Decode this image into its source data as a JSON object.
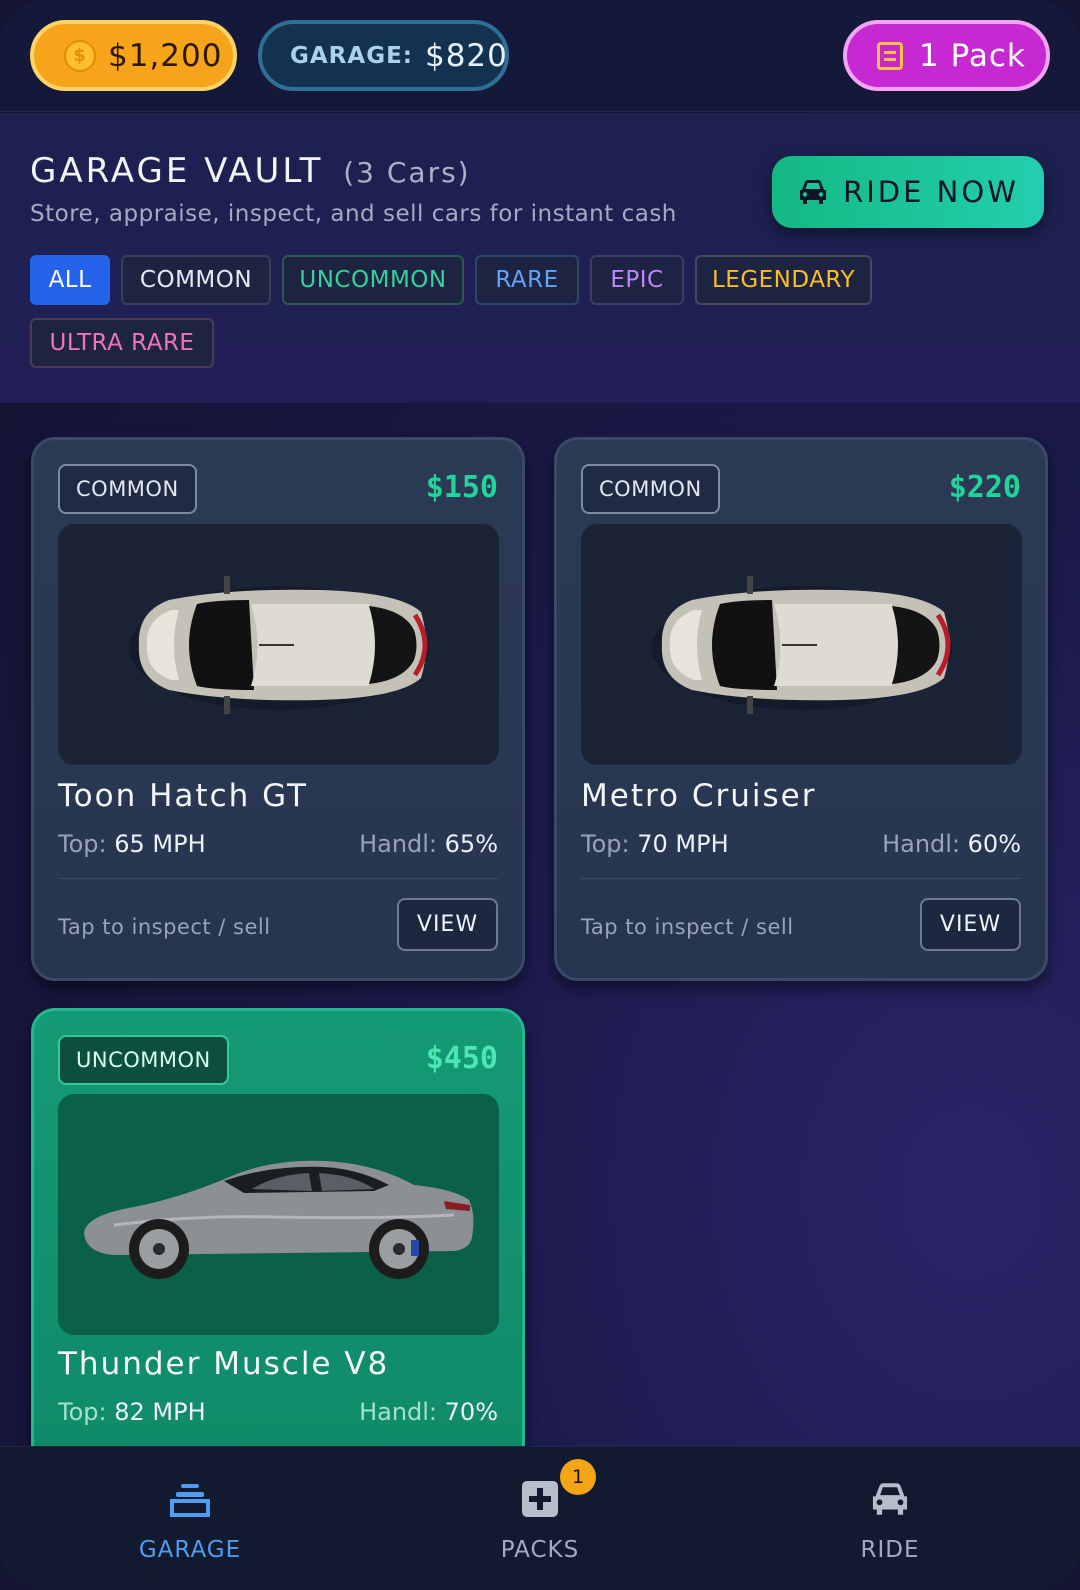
{
  "topbar": {
    "coins": "$1,200",
    "garage_label": "GARAGE:",
    "garage_value": "$820",
    "packs": "1 Pack"
  },
  "header": {
    "title": "GARAGE VAULT",
    "count": "(3 Cars)",
    "subtitle": "Store, appraise, inspect, and sell cars for instant cash",
    "ride_button": "RIDE NOW"
  },
  "filters": [
    {
      "label": "ALL",
      "color": "#ffffff",
      "active": true
    },
    {
      "label": "COMMON",
      "color": "#e5e9f2"
    },
    {
      "label": "UNCOMMON",
      "color": "#34d399"
    },
    {
      "label": "RARE",
      "color": "#60a5fa"
    },
    {
      "label": "EPIC",
      "color": "#c084fc"
    },
    {
      "label": "LEGENDARY",
      "color": "#fbbf24"
    },
    {
      "label": "ULTRA RARE",
      "color": "#f472b6"
    }
  ],
  "cards": [
    {
      "rarity": "COMMON",
      "price": "$150",
      "name": "Toon Hatch GT",
      "top_label": "Top:",
      "top_value": "65 MPH",
      "handl_label": "Handl:",
      "handl_value": "65%",
      "hint": "Tap to inspect / sell",
      "button": "VIEW",
      "image": "car-top-view"
    },
    {
      "rarity": "COMMON",
      "price": "$220",
      "name": "Metro Cruiser",
      "top_label": "Top:",
      "top_value": "70 MPH",
      "handl_label": "Handl:",
      "handl_value": "60%",
      "hint": "Tap to inspect / sell",
      "button": "VIEW",
      "image": "car-top-view"
    },
    {
      "rarity": "UNCOMMON",
      "price": "$450",
      "name": "Thunder Muscle V8",
      "top_label": "Top:",
      "top_value": "82 MPH",
      "handl_label": "Handl:",
      "handl_value": "70%",
      "image": "car-side-view"
    }
  ],
  "nav": [
    {
      "label": "GARAGE",
      "icon": "garage-icon",
      "active": true
    },
    {
      "label": "PACKS",
      "icon": "pack-plus-icon",
      "badge": "1"
    },
    {
      "label": "RIDE",
      "icon": "car-icon"
    }
  ],
  "colors": {
    "accent_green": "#22d39a",
    "coin_gold": "#f6a51b",
    "pack_magenta": "#c629d1",
    "active_blue": "#2563eb"
  }
}
